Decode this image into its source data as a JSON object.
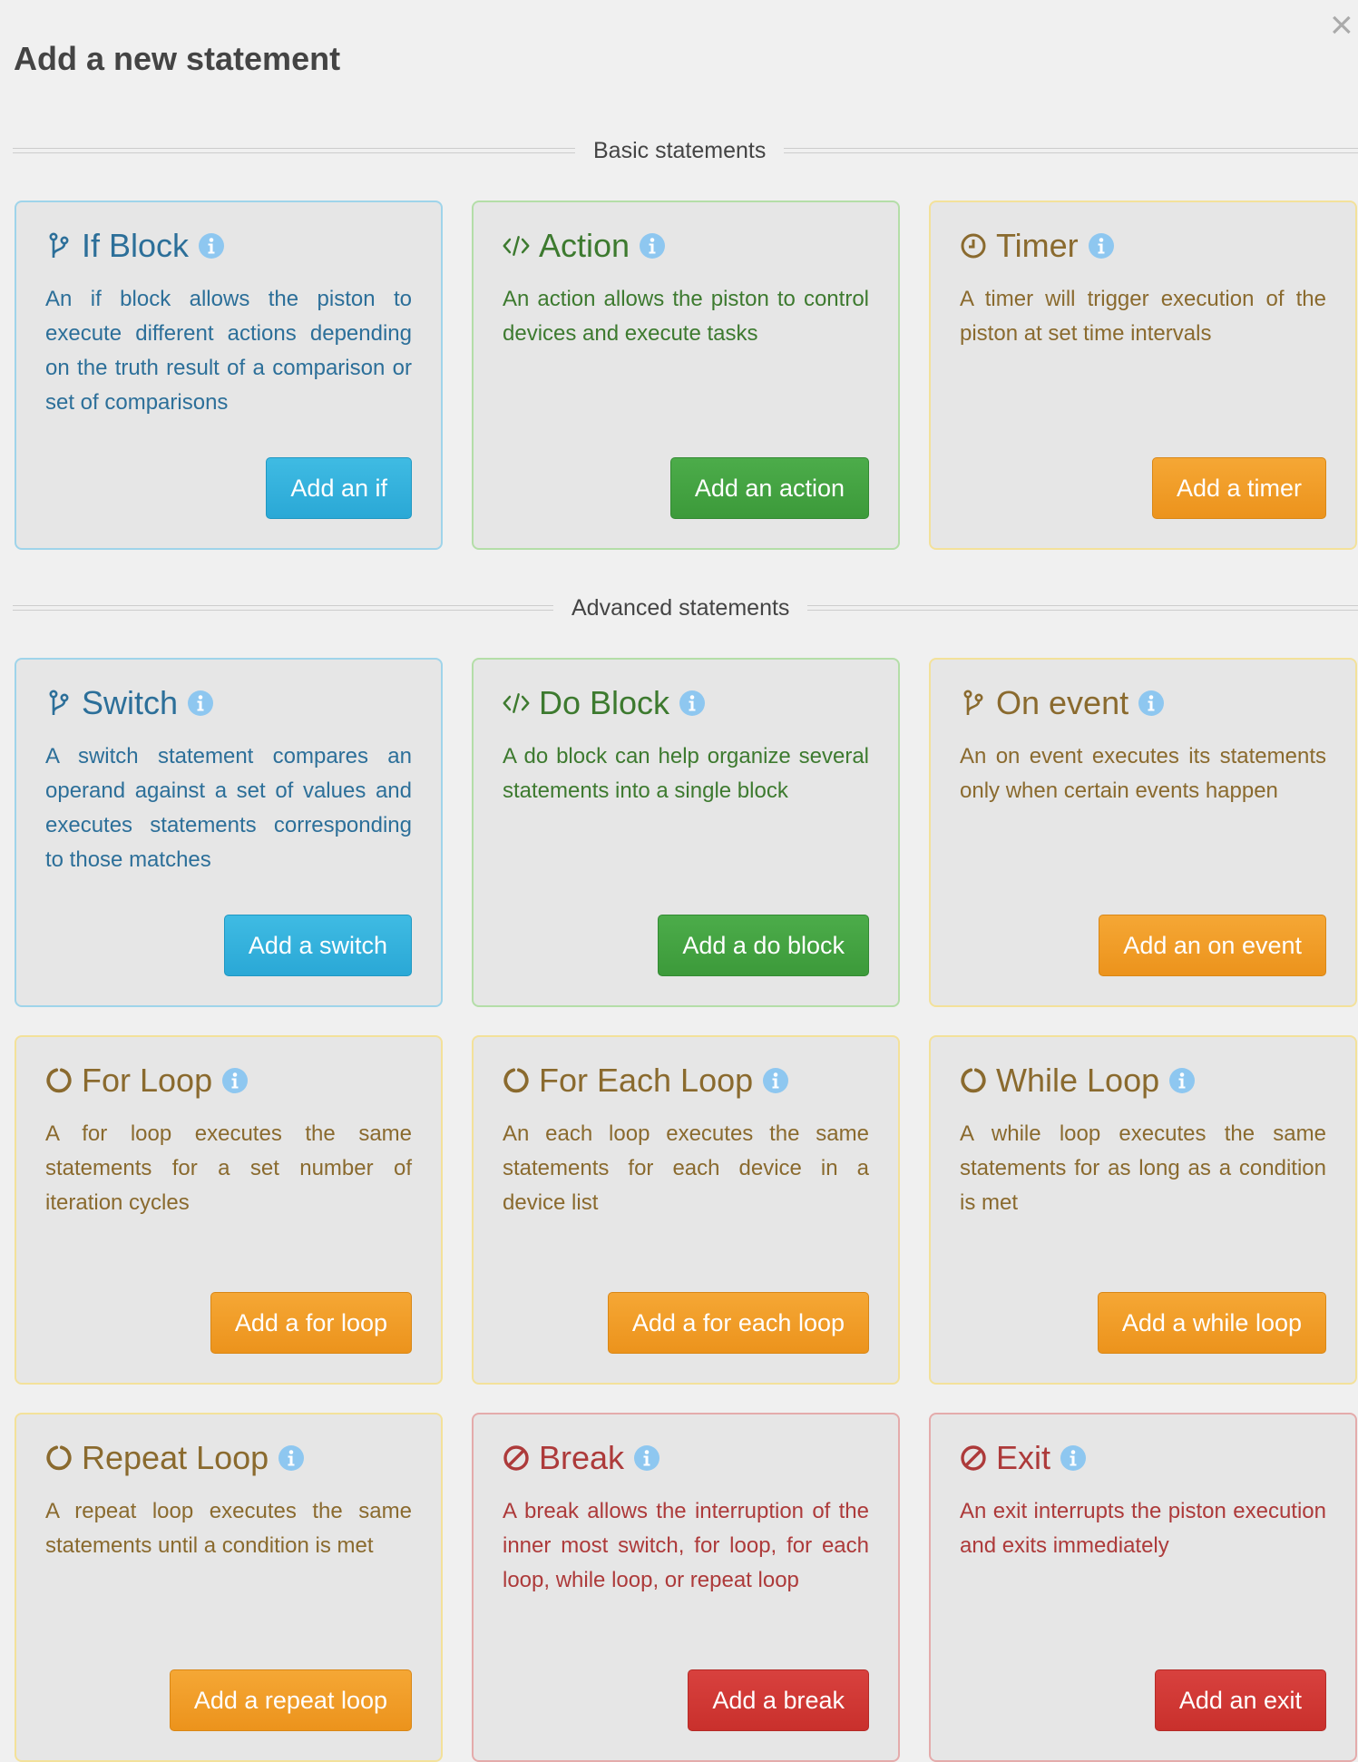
{
  "modal": {
    "title": "Add a new statement",
    "close_icon": "×"
  },
  "sections": [
    {
      "label": "Basic statements",
      "cards": [
        {
          "title": "If Block",
          "icon": "branch-icon",
          "variant": "info",
          "description": "An if block allows the piston to execute different actions depending on the truth result of a comparison or set of comparisons",
          "button": "Add an if"
        },
        {
          "title": "Action",
          "icon": "code-icon",
          "variant": "success",
          "description": "An action allows the piston to control devices and execute tasks",
          "button": "Add an action"
        },
        {
          "title": "Timer",
          "icon": "clock-icon",
          "variant": "warning",
          "description": "A timer will trigger execution of the piston at set time intervals",
          "button": "Add a timer"
        }
      ]
    },
    {
      "label": "Advanced statements",
      "cards": [
        {
          "title": "Switch",
          "icon": "branch-icon",
          "variant": "info",
          "description": "A switch statement compares an operand against a set of values and executes statements corresponding to those matches",
          "button": "Add a switch"
        },
        {
          "title": "Do Block",
          "icon": "code-icon",
          "variant": "success",
          "description": "A do block can help organize several statements into a single block",
          "button": "Add a do block"
        },
        {
          "title": "On event",
          "icon": "branch-icon",
          "variant": "warning",
          "description": "An on event executes its statements only when certain events happen",
          "button": "Add an on event"
        },
        {
          "title": "For Loop",
          "icon": "loop-icon",
          "variant": "warning",
          "description": "A for loop executes the same statements for a set number of iteration cycles",
          "button": "Add a for loop"
        },
        {
          "title": "For Each Loop",
          "icon": "loop-icon",
          "variant": "warning",
          "description": "An each loop executes the same statements for each device in a device list",
          "button": "Add a for each loop"
        },
        {
          "title": "While Loop",
          "icon": "loop-icon",
          "variant": "warning",
          "description": "A while loop executes the same statements for as long as a condition is met",
          "button": "Add a while loop"
        },
        {
          "title": "Repeat Loop",
          "icon": "loop-icon",
          "variant": "warning",
          "description": "A repeat loop executes the same statements until a condition is met",
          "button": "Add a repeat loop"
        },
        {
          "title": "Break",
          "icon": "ban-icon",
          "variant": "danger",
          "description": "A break allows the interruption of the inner most switch, for loop, for each loop, while loop, or repeat loop",
          "button": "Add a break"
        },
        {
          "title": "Exit",
          "icon": "ban-icon",
          "variant": "danger",
          "description": "An exit interrupts the piston execution and exits immediately",
          "button": "Add an exit"
        }
      ]
    }
  ],
  "colors": {
    "info": "#2c6f99",
    "success": "#3d7a2f",
    "warning": "#8a6a2e",
    "danger": "#ad3a3a",
    "info_icon": "#8ec7f0"
  }
}
